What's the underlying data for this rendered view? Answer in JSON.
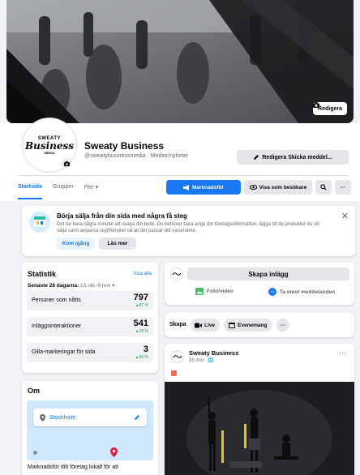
{
  "cover": {
    "edit_label": "Redigera"
  },
  "profile": {
    "logo_line1": "SWEATY",
    "logo_line2": "Business",
    "logo_line3": "MEDIA",
    "name": "Sweaty Business",
    "subtitle": "@sweatybusinessmedia · Medier/nyheter",
    "edit_send_label": "Redigera Skicka meddel..."
  },
  "tabs": [
    {
      "label": "Startsida",
      "active": true
    },
    {
      "label": "Grupper",
      "active": false
    },
    {
      "label": "Fler ▾",
      "active": false
    }
  ],
  "actions": {
    "advertise": "Marknadsför",
    "view_as": "Visa som besökare"
  },
  "setup": {
    "title": "Börja sälja från din sida med några få steg",
    "description": "Det tar bara några minuter att skapa din butik. Du behöver bara ange din företagsinformation, lägga till de produkter du vill sälja samt anpassa skyltfönstret så att det passar ditt varumärke.",
    "start_label": "Kom igång",
    "learn_more_label": "Läs mer"
  },
  "stats": {
    "title": "Statistik",
    "see_all": "Visa alla",
    "period_label": "Senaste 28 dagarna:",
    "period_value": "13 okt–9 nov ▾",
    "items": [
      {
        "label": "Personer som nåtts",
        "value": "797",
        "delta": "▲87 %"
      },
      {
        "label": "Inläggsinteraktioner",
        "value": "541",
        "delta": "▲28 %"
      },
      {
        "label": "Gilla-markeringar för sida",
        "value": "3",
        "delta": "▲50 %"
      }
    ]
  },
  "about": {
    "title": "Om",
    "location": "Stockholm",
    "text": "Marknadsför ditt företag lokalt för att"
  },
  "composer": {
    "create_post": "Skapa inlägg",
    "photo_video": "Foto/video",
    "receive_messages": "Ta emot meddelanden"
  },
  "quick_create": {
    "label": "Skapa",
    "live": "Live",
    "event": "Evenemang",
    "more": "···"
  },
  "post": {
    "author": "Sweaty Business",
    "time": "33 min · 🌐",
    "more": "···"
  },
  "colors": {
    "brand_blue": "#1877f2",
    "positive_green": "#31a24c",
    "page_background": "#f0f2f5"
  }
}
